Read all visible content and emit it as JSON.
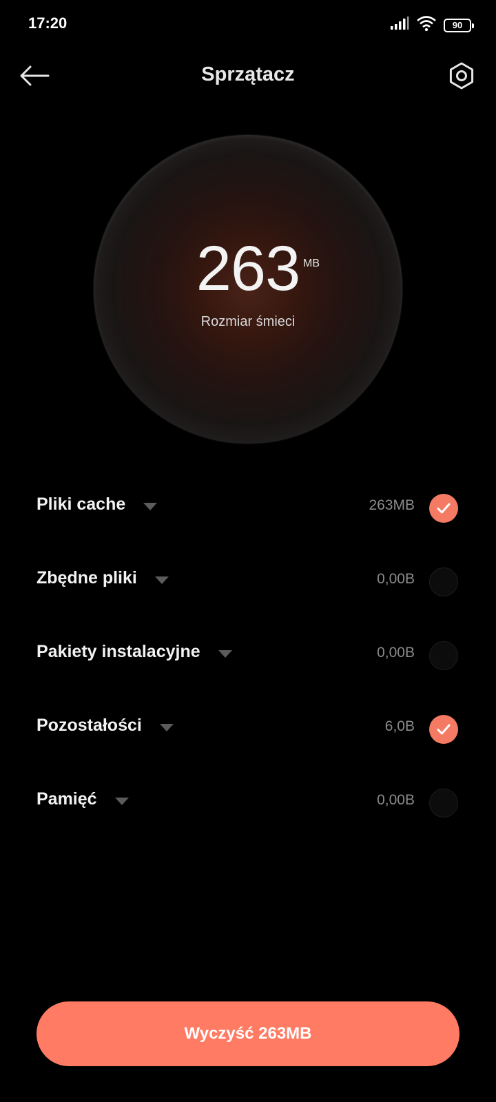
{
  "status_bar": {
    "time": "17:20",
    "battery": "90",
    "icons": [
      "signal-icon",
      "wifi-icon",
      "battery-icon"
    ]
  },
  "header": {
    "title": "Sprzątacz",
    "back_icon": "arrow-left-icon",
    "settings_icon": "settings-hexagon-icon"
  },
  "summary": {
    "value": "263",
    "unit": "MB",
    "label": "Rozmiar śmieci"
  },
  "items": [
    {
      "label": "Pliki cache",
      "size": "263MB",
      "checked": true
    },
    {
      "label": "Zbędne pliki",
      "size": "0,00B",
      "checked": false
    },
    {
      "label": "Pakiety instalacyjne",
      "size": "0,00B",
      "checked": false
    },
    {
      "label": "Pozostałości",
      "size": "6,0B",
      "checked": true
    },
    {
      "label": "Pamięć",
      "size": "0,00B",
      "checked": false
    }
  ],
  "action": {
    "label": "Wyczyść 263MB"
  },
  "colors": {
    "accent": "#ff7b63",
    "background": "#000000"
  }
}
